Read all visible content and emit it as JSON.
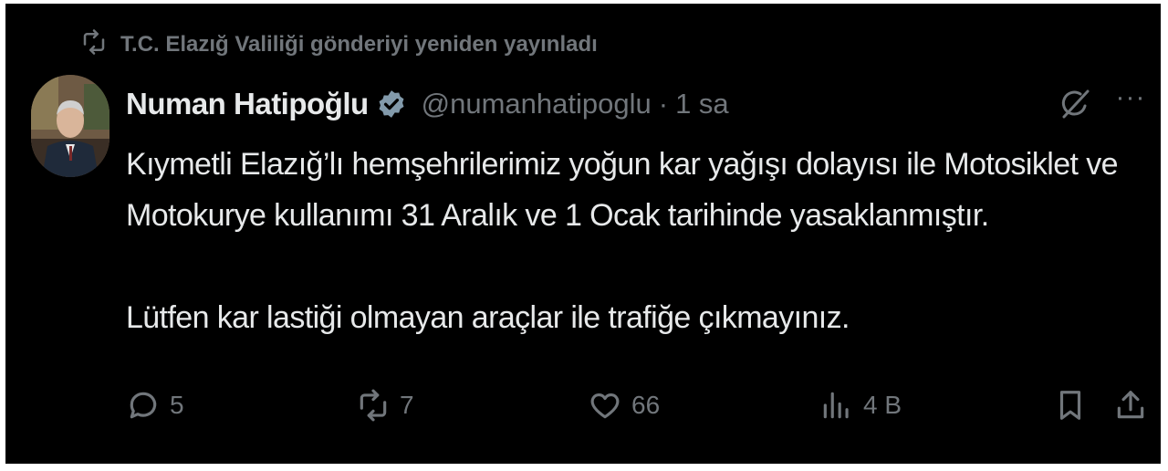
{
  "repost": {
    "text": "T.C. Elazığ Valiliği gönderiyi yeniden yayınladı",
    "icon": "repost-icon"
  },
  "author": {
    "name": "Numan Hatipoğlu",
    "verified_icon": "verified-badge-icon",
    "handle": "@numanhatipoglu",
    "separator": "·",
    "time": "1 sa"
  },
  "top_actions": {
    "grok_icon": "grok-icon",
    "more_label": "···"
  },
  "post": {
    "line1": "Kıymetli Elazığ’lı hemşehrilerimiz yoğun kar yağışı dolayısı ile Motosiklet ve",
    "line2": "Motokurye kullanımı 31 Aralık ve 1 Ocak tarihinde yasaklanmıştır.",
    "line3": "Lütfen kar lastiği olmayan araçlar ile trafiğe çıkmayınız."
  },
  "stats": {
    "replies": "5",
    "reposts": "7",
    "likes": "66",
    "views": "4 B"
  },
  "colors": {
    "background": "#000000",
    "text": "#e7e9ea",
    "muted": "#71767b",
    "verified": "#829aab"
  }
}
